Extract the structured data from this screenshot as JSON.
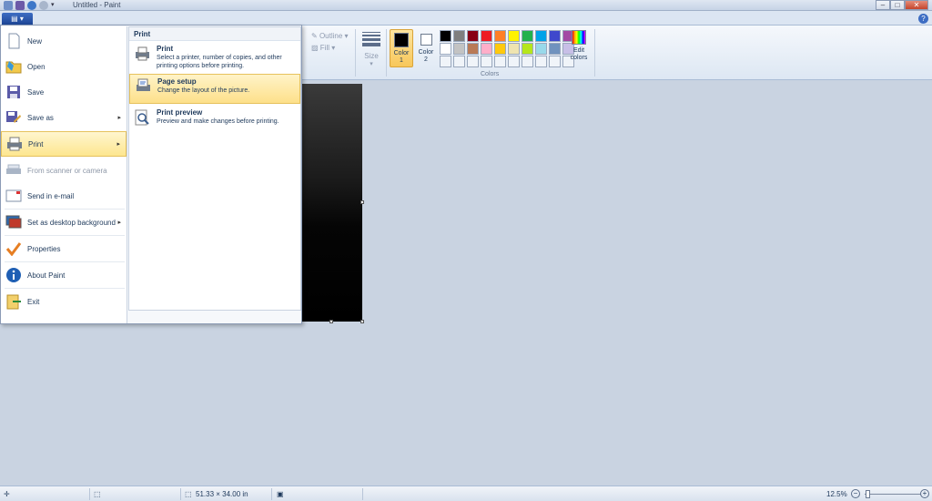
{
  "window": {
    "title": "Untitled - Paint"
  },
  "ribbon": {
    "outline_label": "Outline",
    "fill_label": "Fill",
    "size_label": "Size",
    "color1_label": "Color 1",
    "color2_label": "Color 2",
    "edit_colors_label": "Edit colors",
    "colors_group_label": "Colors",
    "color1_value": "#000000",
    "color2_value": "#ffffff",
    "palette": [
      "#000000",
      "#7f7f7f",
      "#880015",
      "#ed1c24",
      "#ff7f27",
      "#fff200",
      "#22b14c",
      "#00a2e8",
      "#3f48cc",
      "#a349a4",
      "#ffffff",
      "#c3c3c3",
      "#b97a57",
      "#ffaec9",
      "#ffc90e",
      "#efe4b0",
      "#b5e61d",
      "#99d9ea",
      "#7092be",
      "#c8bfe7",
      "#f0f4f9",
      "#f0f4f9",
      "#f0f4f9",
      "#f0f4f9",
      "#f0f4f9",
      "#f0f4f9",
      "#f0f4f9",
      "#f0f4f9",
      "#f0f4f9",
      "#f0f4f9"
    ]
  },
  "app_menu": {
    "items": [
      {
        "label": "New",
        "icon": "new-document-icon"
      },
      {
        "label": "Open",
        "icon": "open-folder-icon"
      },
      {
        "label": "Save",
        "icon": "save-disk-icon"
      },
      {
        "label": "Save as",
        "icon": "save-as-icon",
        "submenu": true
      },
      {
        "label": "Print",
        "icon": "printer-icon",
        "submenu": true,
        "active": true
      },
      {
        "label": "From scanner or camera",
        "icon": "scanner-icon",
        "disabled": true
      },
      {
        "label": "Send in e-mail",
        "icon": "email-icon"
      },
      {
        "label": "Set as desktop background",
        "icon": "desktop-background-icon",
        "submenu": true
      },
      {
        "label": "Properties",
        "icon": "properties-check-icon"
      },
      {
        "label": "About Paint",
        "icon": "info-icon"
      },
      {
        "label": "Exit",
        "icon": "exit-icon"
      }
    ],
    "submenu": {
      "header": "Print",
      "items": [
        {
          "title": "Print",
          "desc": "Select a printer, number of copies, and other printing options before printing."
        },
        {
          "title": "Page setup",
          "desc": "Change the layout of the picture.",
          "active": true
        },
        {
          "title": "Print preview",
          "desc": "Preview and make changes before printing."
        }
      ]
    }
  },
  "status": {
    "dimensions": "51.33 × 34.00 in",
    "zoom": "12.5%",
    "zoom_fraction": 0.0
  }
}
